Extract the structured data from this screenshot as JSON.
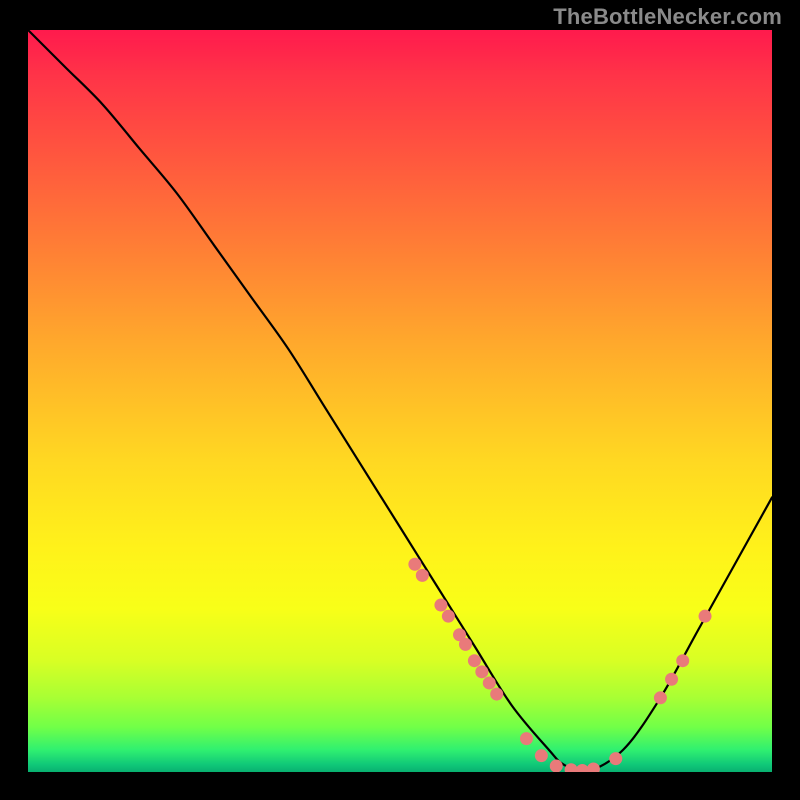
{
  "attribution": "TheBottleNecker.com",
  "colors": {
    "background": "#000000",
    "curve": "#000000",
    "marker": "#e97a7a",
    "gradient_top": "#ff1a4d",
    "gradient_bottom": "#08b070"
  },
  "chart_data": {
    "type": "line",
    "title": "",
    "xlabel": "",
    "ylabel": "",
    "xlim": [
      0,
      100
    ],
    "ylim": [
      0,
      100
    ],
    "grid": false,
    "legend": false,
    "series": [
      {
        "name": "bottleneck-curve",
        "x": [
          0,
          5,
          10,
          15,
          20,
          25,
          30,
          35,
          40,
          45,
          50,
          55,
          60,
          65,
          70,
          72,
          75,
          80,
          85,
          90,
          95,
          100
        ],
        "values": [
          100,
          95,
          90,
          84,
          78,
          71,
          64,
          57,
          49,
          41,
          33,
          25,
          17,
          9,
          3,
          1,
          0,
          3,
          10,
          19,
          28,
          37
        ]
      }
    ],
    "markers": {
      "name": "highlighted-points",
      "x": [
        52,
        53,
        55.5,
        56.5,
        58,
        58.8,
        60,
        61,
        62,
        63,
        67,
        69,
        71,
        73,
        74.5,
        76,
        79,
        85,
        86.5,
        88,
        91
      ],
      "values": [
        28,
        26.5,
        22.5,
        21,
        18.5,
        17.2,
        15,
        13.5,
        12,
        10.5,
        4.5,
        2.2,
        0.8,
        0.3,
        0.2,
        0.4,
        1.8,
        10,
        12.5,
        15,
        21
      ]
    },
    "annotations": []
  }
}
